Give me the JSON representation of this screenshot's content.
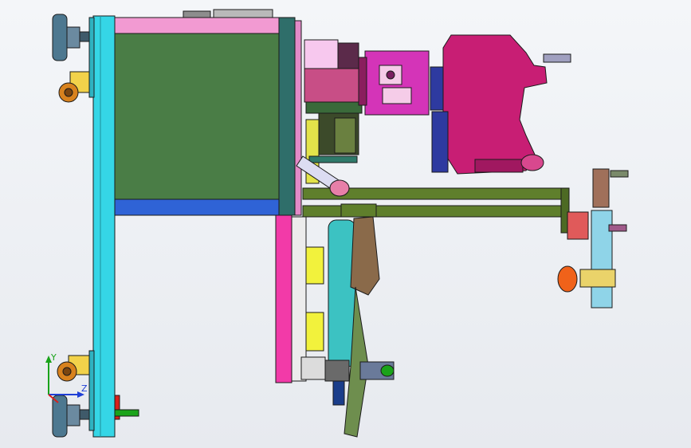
{
  "view": {
    "background_top": "#f4f6f9",
    "background_bottom": "#e7eaef"
  },
  "triad": {
    "y_label": "Y",
    "z_label": "Z",
    "y_color": "#1aa31a",
    "z_color": "#1f3fd6",
    "x_color": "#d8201a"
  },
  "colors": {
    "frame_cyan": "#35d6e6",
    "frame_pink": "#f29ad2",
    "panel_green": "#4a7d46",
    "plate_blue": "#2f63d6",
    "plate_teal": "#2f6e6a",
    "magenta": "#c81e74",
    "rod_olive": "#5f7f2c",
    "cylinder_teal": "#3cc2c2",
    "caster_orange": "#d8821e",
    "caster_yellow": "#f2d24a",
    "foot_slate": "#4d7890",
    "yellow_rail": "#f2f23c",
    "hot_pink": "#f23aa8"
  }
}
